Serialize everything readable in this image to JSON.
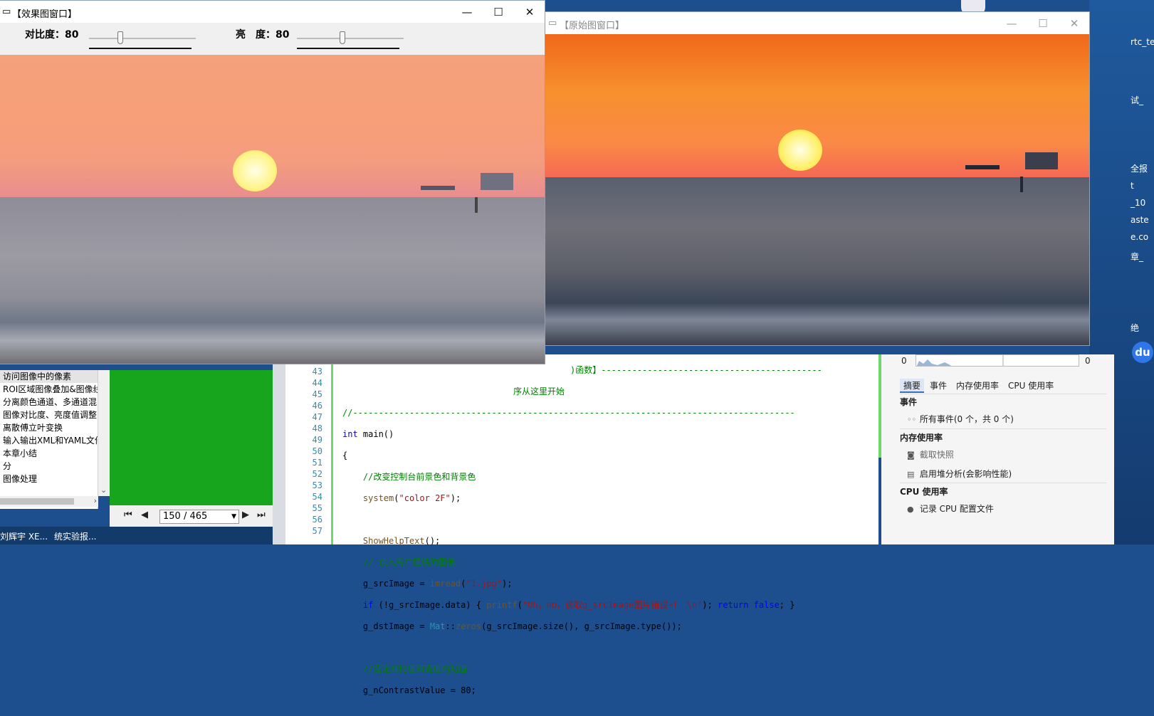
{
  "effect_window": {
    "title": "【效果图窗口】",
    "contrast_label": "对比度：",
    "contrast_value": "80",
    "brightness_label": "亮　度：",
    "brightness_value": "80"
  },
  "original_window": {
    "title": "【原始图窗口】"
  },
  "window_controls": {
    "minimize": "—",
    "maximize": "☐",
    "close": "✕"
  },
  "sliders": {
    "contrast": {
      "value": 80,
      "max": 300
    },
    "brightness": {
      "value": 80,
      "max": 200
    }
  },
  "tree": {
    "items": [
      "访问图像中的像素",
      "ROI区域图像叠加&图像线",
      "分离颜色通道、多通道混",
      "图像对比度、亮度值调整",
      "离散傅立叶变换",
      "输入输出XML和YAML文件",
      "本章小结",
      "分",
      "图像处理"
    ]
  },
  "pager": {
    "page": "150 / 465"
  },
  "taskbar": {
    "item1": "刘辉宇 XE...",
    "item2": "统实验报..."
  },
  "editor": {
    "line_numbers": [
      "",
      "43",
      "44",
      "45",
      "46",
      "47",
      "48",
      "49",
      "50",
      "51",
      "52",
      "53",
      "54",
      "55",
      "56",
      "57"
    ],
    "partial_top": ")函数】-------------------------------------------",
    "partial_top2": "序从这里开始"
  },
  "diagnostics": {
    "chart_min": "0",
    "chart_max": "0",
    "tabs": [
      "摘要",
      "事件",
      "内存使用率",
      "CPU 使用率"
    ],
    "events_header": "事件",
    "all_events": "所有事件(0 个，共 0 个)",
    "memory_header": "内存使用率",
    "snapshot": "截取快照",
    "heap_analysis": "启用堆分析(会影响性能)",
    "cpu_header": "CPU 使用率",
    "cpu_profile": "记录 CPU 配置文件"
  },
  "desktop": {
    "labels": [
      "rtc_tes",
      "试_",
      "全报",
      "t",
      "_10",
      "aste",
      "e.co",
      "章_",
      "绝"
    ],
    "du_label": "du"
  }
}
